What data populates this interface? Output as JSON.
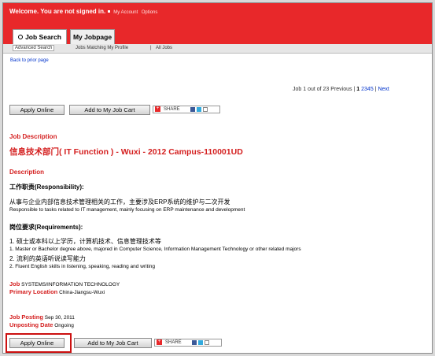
{
  "header": {
    "welcome": "Welcome. You are not signed in.",
    "my_account": "My Account",
    "options": "Options"
  },
  "tabs": {
    "job_search": "Job Search",
    "my_jobpage": "My Jobpage"
  },
  "subnav": {
    "advanced_search": "Advanced Search",
    "jobs_matching": "Jobs Matching My Profile",
    "all_jobs": "All Jobs"
  },
  "back_link": "Back to prior page",
  "pager": {
    "summary": "Job 1 out of 23",
    "previous": "Previous",
    "current": "1",
    "p2": "2",
    "p3": "3",
    "p4": "4",
    "p5": "5",
    "next": "Next"
  },
  "actions": {
    "apply_online": "Apply Online",
    "add_to_cart": "Add to My Job Cart",
    "share": "SHARE"
  },
  "job": {
    "section_heading": "Job Description",
    "title": "信息技术部门( IT Function ) - Wuxi - 2012 Campus-110001UD",
    "description_heading": "Description",
    "responsibility_heading": "工作职责(Responsibility):",
    "responsibility_cn": "从事与企业内部信息技术管理相关的工作，主要涉及ERP系统的维护与二次开发",
    "responsibility_en": "Responsible to tasks related to IT management, mainly focusing on ERP maintenance and development",
    "requirements_heading": "岗位要求(Requirements):",
    "req1_cn": "1. 硕士或本科以上学历，计算机技术、信息管理技术等",
    "req1_en": "1. Master or Bachelor degree above, majored in Computer Science, Information Management Technology or other related majors",
    "req2_cn": "2. 流利的英语听说读写能力",
    "req2_en": "2. Fluent English skills in listening, speaking, reading and writing",
    "job_label": "Job",
    "job_value": "SYSTEMS/INFORMATION TECHNOLOGY",
    "location_label": "Primary Location",
    "location_value": "China-Jiangsu-Wuxi",
    "posting_label": "Job Posting",
    "posting_value": "Sep 30, 2011",
    "unposting_label": "Unposting Date",
    "unposting_value": "Ongoing"
  },
  "colors": {
    "brand_red": "#e8282a",
    "link_blue": "#0033cc",
    "heading_red": "#d41f1f"
  }
}
